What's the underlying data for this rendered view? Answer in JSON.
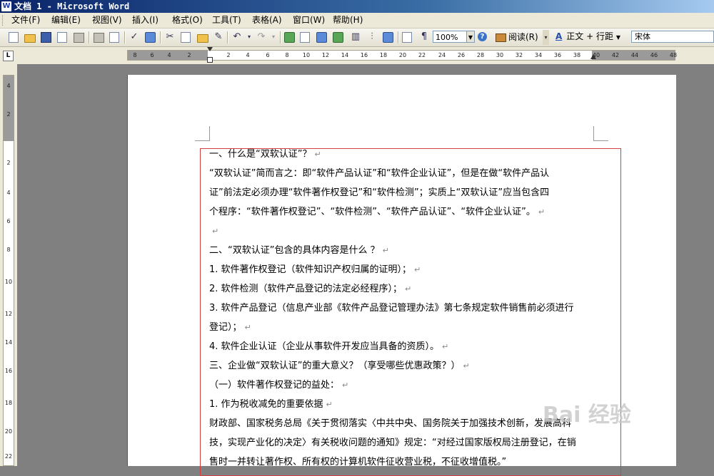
{
  "window": {
    "title": "文档 1 - Microsoft Word"
  },
  "menu": [
    "文件(F)",
    "编辑(E)",
    "视图(V)",
    "插入(I)",
    "格式(O)",
    "工具(T)",
    "表格(A)",
    "窗口(W)",
    "帮助(H)"
  ],
  "toolbar": {
    "zoom": "100%",
    "read_label": "阅读(R)",
    "style_value": "正文 + 行距",
    "font_value": "宋体",
    "icons": [
      "new-icon",
      "open-icon",
      "save-icon",
      "permission-icon",
      "email-icon",
      "print-icon",
      "print-preview-icon",
      "spelling-icon",
      "research-icon",
      "cut-icon",
      "copy-icon",
      "paste-icon",
      "format-painter-icon",
      "undo-icon",
      "redo-icon",
      "hyperlink-icon",
      "tables-borders-icon",
      "insert-table-icon",
      "insert-excel-icon",
      "columns-icon",
      "drawing-icon",
      "document-map-icon",
      "show-hide-icon",
      "help-icon"
    ]
  },
  "ruler": {
    "h_ticks": [
      "8",
      "6",
      "4",
      "2",
      "2",
      "4",
      "6",
      "8",
      "10",
      "12",
      "14",
      "16",
      "18",
      "20",
      "22",
      "24",
      "26",
      "28",
      "30",
      "32",
      "34",
      "36",
      "38",
      "40",
      "42",
      "44",
      "46",
      "48"
    ],
    "v_ticks": [
      "4",
      "2",
      "2",
      "4",
      "6",
      "8",
      "10",
      "12",
      "14",
      "16",
      "18",
      "20",
      "22"
    ]
  },
  "document": {
    "lines": [
      "一、什么是“双软认证”？",
      "  “双软认证”简而言之：即“软件产品认证”和“软件企业认证”，但是在做“软件产品认",
      "证”前法定必须办理“软件著作权登记”和“软件检测”；实质上“双软认证”应当包含四",
      "个程序：“软件著作权登记”、“软件检测”、“软件产品认证”、“软件企业认证”。",
      "",
      "二、“双软认证”包含的具体内容是什么 ？",
      "1. 软件著作权登记（软件知识产权归属的证明）；",
      "  2. 软件检测（软件产品登记的法定必经程序）；",
      "  3. 软件产品登记（信息产业部《软件产品登记管理办法》第七条规定软件销售前必须进行",
      "登记）；",
      "  4. 软件企业认证（企业从事软件开发应当具备的资质）。",
      "三、企业做“双软认证”的重大意义？（享受哪些优惠政策？）",
      " （一）软件著作权登记的益处：",
      "  1. 作为税收减免的重要依据",
      "  财政部、国家税务总局《关于贯彻落实〈中共中央、国务院关于加强技术创新，发展高科",
      "技，实现产业化的决定〉有关税收问题的通知》规定：“对经过国家版权局注册登记，在销",
      "售时一并转让著作权、所有权的计算机软件征收营业税，不征收增值税。”"
    ],
    "paragraph_mark": "↵"
  },
  "watermark": {
    "text": "Bai 经验"
  }
}
